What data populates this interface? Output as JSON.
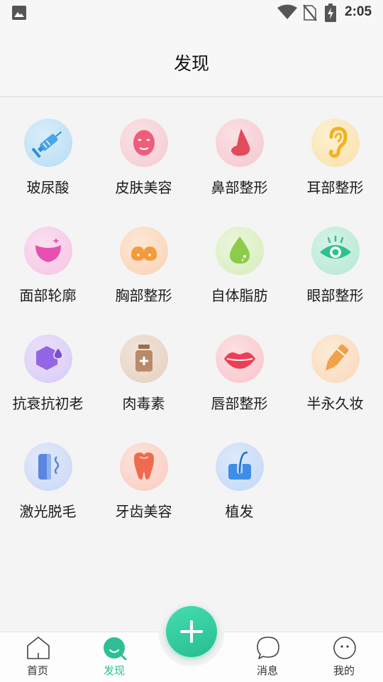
{
  "status_bar": {
    "time": "2:05"
  },
  "header": {
    "title": "发现"
  },
  "categories": [
    {
      "label": "玻尿酸",
      "icon": "syringe-icon",
      "color": "#4aa6e6"
    },
    {
      "label": "皮肤美容",
      "icon": "face-mask-icon",
      "color": "#ee5d7a"
    },
    {
      "label": "鼻部整形",
      "icon": "nose-icon",
      "color": "#e24b5b"
    },
    {
      "label": "耳部整形",
      "icon": "ear-icon",
      "color": "#f2b320"
    },
    {
      "label": "面部轮廓",
      "icon": "face-contour-icon",
      "color": "#e84fb0"
    },
    {
      "label": "胸部整形",
      "icon": "chest-icon",
      "color": "#f59a3c"
    },
    {
      "label": "自体脂肪",
      "icon": "fat-drop-icon",
      "color": "#8ccc4a"
    },
    {
      "label": "眼部整形",
      "icon": "eye-icon",
      "color": "#2ec18b"
    },
    {
      "label": "抗衰抗初老",
      "icon": "hexagon-drop-icon",
      "color": "#9466e6"
    },
    {
      "label": "肉毒素",
      "icon": "vial-icon",
      "color": "#b98a6a"
    },
    {
      "label": "唇部整形",
      "icon": "lips-icon",
      "color": "#ee3d56"
    },
    {
      "label": "半永久妆",
      "icon": "eyebrow-pencil-icon",
      "color": "#f2a04a"
    },
    {
      "label": "激光脱毛",
      "icon": "laser-icon",
      "color": "#5a86e0"
    },
    {
      "label": "牙齿美容",
      "icon": "tooth-icon",
      "color": "#f06a4e"
    },
    {
      "label": "植发",
      "icon": "hair-follicle-icon",
      "color": "#3e8ee8"
    }
  ],
  "bottom_nav": {
    "home": "首页",
    "discover": "发现",
    "messages": "消息",
    "mine": "我的",
    "active": "discover",
    "accent": "#2fbf95"
  }
}
